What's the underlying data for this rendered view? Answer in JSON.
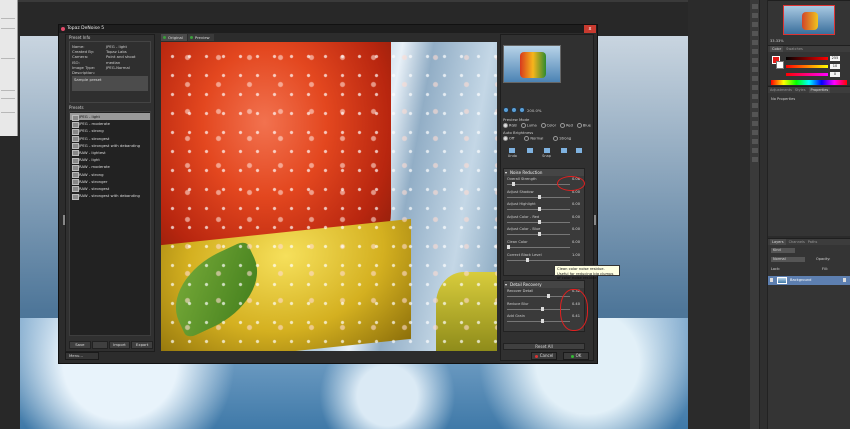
{
  "dialog": {
    "title": "Topaz DeNoise 5",
    "close": "x",
    "preset_info_label": "Preset Info",
    "info": [
      {
        "k": "Name:",
        "v": "JPEG - light"
      },
      {
        "k": "Created By:",
        "v": "Topaz Labs"
      },
      {
        "k": "Camera:",
        "v": "Point and shoot"
      },
      {
        "k": "ISO:",
        "v": "median"
      },
      {
        "k": "Image Type:",
        "v": "JPEG-Normal"
      },
      {
        "k": "Description:",
        "v": ""
      }
    ],
    "description": "Sample preset",
    "presets_label": "Presets",
    "presets": [
      "JPEG - light",
      "JPEG - moderate",
      "JPEG - strong",
      "JPEG - strongest",
      "JPEG - strongest with debanding",
      "RAW - lightest",
      "RAW - light",
      "RAW - moderate",
      "RAW - strong",
      "RAW - stronger",
      "RAW - strongest",
      "RAW - strongest with debanding"
    ],
    "list_buttons": {
      "save": "Save",
      "blank": "",
      "import": "Import",
      "export": "Export"
    },
    "menu": "Menu...",
    "tabs": {
      "original": "Original",
      "preview": "Preview"
    },
    "zoom_value": "200.0%",
    "preview_mode_label": "Preview Mode",
    "preview_modes": [
      "RGB",
      "Luma",
      "Color",
      "Red",
      "Blue"
    ],
    "auto_brightness_label": "Auto Brightness",
    "auto_brightness": [
      "Off",
      "Normal",
      "Strong"
    ],
    "icons": {
      "undo": "Undo",
      "snap": "Snap"
    },
    "noise_reduction": {
      "title": "Noise Reduction",
      "sliders": [
        {
          "label": "Overall Strength",
          "value": "0.08",
          "pos": 0.08
        },
        {
          "label": "Adjust Shadow",
          "value": "0.00",
          "pos": 0.5
        },
        {
          "label": "Adjust Highlight",
          "value": "0.00",
          "pos": 0.5
        },
        {
          "label": "Adjust Color - Red",
          "value": "0.00",
          "pos": 0.5
        },
        {
          "label": "Adjust Color - Blue",
          "value": "0.00",
          "pos": 0.5
        },
        {
          "label": "Clean Color",
          "value": "0.00",
          "pos": 0.0
        },
        {
          "label": "Correct Black Level",
          "value": "1.00",
          "pos": 0.3
        }
      ]
    },
    "detail_recovery": {
      "title": "Detail Recovery",
      "sliders": [
        {
          "label": "Recover Detail",
          "value": "0.32",
          "pos": 0.65
        },
        {
          "label": "Reduce Blur",
          "value": "0.40",
          "pos": 0.55
        },
        {
          "label": "Add Grain",
          "value": "0.41",
          "pos": 0.55
        }
      ]
    },
    "reset": "Reset All",
    "cancel": "Cancel",
    "ok": "OK",
    "tooltip": "Clean color noise residue.\nUseful for reducing big clumps of color noise residue."
  },
  "ps": {
    "nav_zoom": "33.33%",
    "panel_tabs_color": [
      "Color",
      "Swatches"
    ],
    "panel_tabs_adj": [
      "Adjustments",
      "Styles",
      "Properties"
    ],
    "no_properties": "No Properties",
    "color_values": [
      "255",
      "10",
      "0"
    ],
    "layers_tabs": [
      "Layers",
      "Channels",
      "Paths"
    ],
    "layer_name": "Background",
    "kind": "Kind",
    "normal": "Normal",
    "opacity": "Opacity:",
    "lock": "Lock:",
    "fill": "Fill:"
  }
}
